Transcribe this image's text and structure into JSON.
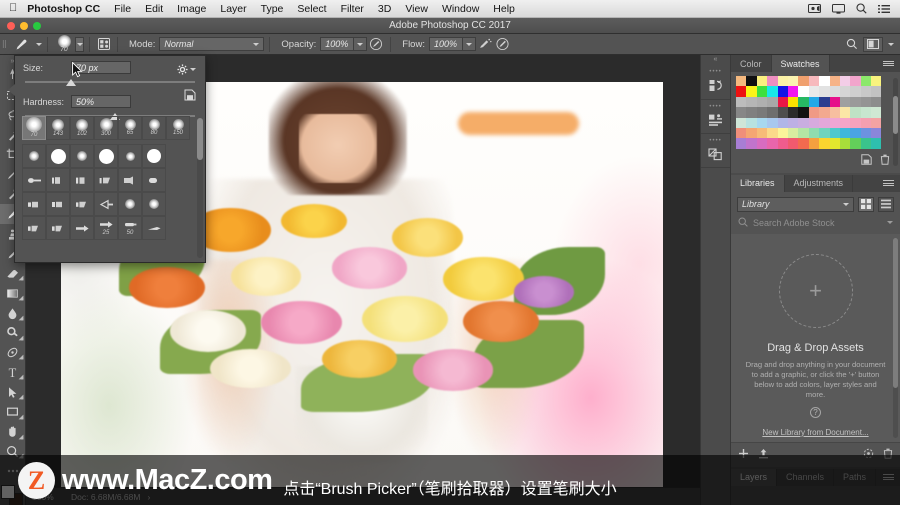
{
  "macbar": {
    "apple_icon": "apple-icon",
    "items": [
      {
        "label": "Photoshop CC",
        "bold": true
      },
      {
        "label": "File",
        "bold": false
      },
      {
        "label": "Edit",
        "bold": false
      },
      {
        "label": "Image",
        "bold": false
      },
      {
        "label": "Layer",
        "bold": false
      },
      {
        "label": "Type",
        "bold": false
      },
      {
        "label": "Select",
        "bold": false
      },
      {
        "label": "Filter",
        "bold": false
      },
      {
        "label": "3D",
        "bold": false
      },
      {
        "label": "View",
        "bold": false
      },
      {
        "label": "Window",
        "bold": false
      },
      {
        "label": "Help",
        "bold": false
      }
    ],
    "status_icons": [
      "screen-record-icon",
      "display-icon",
      "spotlight-search-icon",
      "control-center-icon"
    ]
  },
  "titlebar": {
    "title": "Adobe Photoshop CC 2017",
    "window_buttons": [
      "close-button",
      "minimize-button",
      "zoom-button"
    ]
  },
  "optionsbar": {
    "tool_icon": "brush-tool-icon",
    "brush_size_value": "70",
    "preset_picker_icon": "brush-preset-picker-icon",
    "toggle_panel_icon": "toggle-brush-panel-icon",
    "mode_label": "Mode:",
    "mode_value": "Normal",
    "opacity_label": "Opacity:",
    "opacity_value": "100%",
    "pressure_opacity_icon": "tablet-pressure-opacity-icon",
    "flow_label": "Flow:",
    "flow_value": "100%",
    "airbrush_icon": "airbrush-icon",
    "smoothing_icon": "smoothing-icon",
    "symmetry_icon": "symmetry-icon",
    "search_icon": "search-icon",
    "workspace_icon": "workspace-switcher-icon"
  },
  "tools": {
    "items": [
      {
        "name": "move-tool",
        "glyph": "move"
      },
      {
        "name": "marquee-tool",
        "glyph": "marquee"
      },
      {
        "name": "lasso-tool",
        "glyph": "lasso"
      },
      {
        "name": "quick-selection-tool",
        "glyph": "wand"
      },
      {
        "name": "crop-tool",
        "glyph": "crop"
      },
      {
        "name": "eyedropper-tool",
        "glyph": "eyedropper"
      },
      {
        "name": "healing-brush-tool",
        "glyph": "heal"
      },
      {
        "name": "brush-tool",
        "glyph": "brush",
        "selected": true
      },
      {
        "name": "clone-stamp-tool",
        "glyph": "stamp"
      },
      {
        "name": "history-brush-tool",
        "glyph": "historybrush"
      },
      {
        "name": "eraser-tool",
        "glyph": "eraser"
      },
      {
        "name": "gradient-tool",
        "glyph": "gradient"
      },
      {
        "name": "blur-tool",
        "glyph": "blur"
      },
      {
        "name": "dodge-tool",
        "glyph": "dodge"
      },
      {
        "name": "pen-tool",
        "glyph": "pen"
      },
      {
        "name": "type-tool",
        "glyph": "type"
      },
      {
        "name": "path-selection-tool",
        "glyph": "pathselect"
      },
      {
        "name": "rectangle-tool",
        "glyph": "rectangle"
      },
      {
        "name": "hand-tool",
        "glyph": "hand"
      },
      {
        "name": "zoom-tool",
        "glyph": "zoom"
      },
      {
        "name": "edit-toolbar",
        "glyph": "dots"
      }
    ],
    "foreground_color": "#ffffff",
    "background_color": "#3d2a20"
  },
  "brush_picker": {
    "size_label": "Size:",
    "size_value": "70 px",
    "size_slider_pct": 24,
    "hardness_label": "Hardness:",
    "hardness_value": "50%",
    "hardness_slider_pct": 50,
    "gear_icon": "settings-gear-icon",
    "new_preset_icon": "new-brush-preset-icon",
    "recent_row": [
      {
        "label": "70",
        "selected": true,
        "size": 16,
        "type": "soft"
      },
      {
        "label": "143",
        "selected": false,
        "size": 12,
        "type": "soft"
      },
      {
        "label": "102",
        "selected": false,
        "size": 12,
        "type": "soft"
      },
      {
        "label": "300",
        "selected": false,
        "size": 13,
        "type": "soft"
      },
      {
        "label": "65",
        "selected": false,
        "size": 11,
        "type": "soft"
      },
      {
        "label": "80",
        "selected": false,
        "size": 11,
        "type": "soft"
      },
      {
        "label": "150",
        "selected": false,
        "size": 11,
        "type": "soft"
      }
    ],
    "grid_rows": [
      [
        {
          "type": "soft",
          "size": 10,
          "label": ""
        },
        {
          "type": "hard",
          "size": 15,
          "label": ""
        },
        {
          "type": "soft",
          "size": 10,
          "label": ""
        },
        {
          "type": "hard",
          "size": 15,
          "label": ""
        },
        {
          "type": "soft",
          "size": 9,
          "label": ""
        },
        {
          "type": "hard",
          "size": 14,
          "label": ""
        }
      ],
      [
        {
          "type": "bristle",
          "size": 0,
          "label": ""
        },
        {
          "type": "bristle",
          "size": 0,
          "label": ""
        },
        {
          "type": "bristle",
          "size": 0,
          "label": ""
        },
        {
          "type": "bristle",
          "size": 0,
          "label": ""
        },
        {
          "type": "bristle",
          "size": 0,
          "label": ""
        },
        {
          "type": "bristle",
          "size": 0,
          "label": ""
        }
      ],
      [
        {
          "type": "bristle",
          "size": 0,
          "label": ""
        },
        {
          "type": "bristle",
          "size": 0,
          "label": ""
        },
        {
          "type": "bristle",
          "size": 0,
          "label": ""
        },
        {
          "type": "bristle",
          "size": 0,
          "label": ""
        },
        {
          "type": "soft",
          "size": 10,
          "label": ""
        },
        {
          "type": "soft",
          "size": 10,
          "label": ""
        }
      ],
      [
        {
          "type": "bristle",
          "size": 0,
          "label": ""
        },
        {
          "type": "bristle",
          "size": 0,
          "label": ""
        },
        {
          "type": "bristle",
          "size": 0,
          "label": ""
        },
        {
          "type": "bristle",
          "size": 0,
          "label": "25"
        },
        {
          "type": "bristle",
          "size": 0,
          "label": "50"
        },
        {
          "type": "bristle",
          "size": 0,
          "label": ""
        }
      ]
    ]
  },
  "canvas": {
    "stroke_color": "#f5a961",
    "document_background": "#ffffff"
  },
  "color_panel": {
    "tabs": [
      {
        "label": "Color",
        "active": false
      },
      {
        "label": "Swatches",
        "active": true
      }
    ],
    "menu_icon": "panel-menu-icon",
    "new_swatch_icon": "new-swatch-icon",
    "delete_swatch_icon": "delete-swatch-icon",
    "swatch_rows": [
      [
        "#f5b97f",
        "#111111",
        "#fbf080",
        "#ef8fc0",
        "#fbf2a6",
        "#fbf3b0",
        "#f0a06e",
        "#f7b9bd",
        "#ffffff",
        "#f6b387",
        "#f3cde7",
        "#f2a5cc",
        "#8ce86b",
        "#f9f37e"
      ],
      [
        "#ee1111",
        "#fbf417",
        "#3ee03e",
        "#18e8e8",
        "#1414e6",
        "#f117f1",
        "#ffffff",
        "#e9e9e9",
        "#e2e2e2",
        "#dcdcdc",
        "#d5d5d5",
        "#cfcfcf",
        "#c8c8c8",
        "#c2c2c2"
      ],
      [
        "#bcbcbc",
        "#b5b5b5",
        "#afafaf",
        "#a8a8a8",
        "#ea1745",
        "#fbe300",
        "#27b863",
        "#22a8e6",
        "#2b3d8f",
        "#e6108a",
        "#a0a0a0",
        "#9a9a9a",
        "#949494",
        "#8d8d8d"
      ],
      [
        "#878787",
        "#808080",
        "#7a7a7a",
        "#6e6e6e",
        "#4e4e4e",
        "#2b2b2b",
        "#111111",
        "#f09a85",
        "#f3a98f",
        "#f7bfa0",
        "#fbe6a6",
        "#bfe2c5",
        "#c7e6cf",
        "#cfe8d3"
      ],
      [
        "#cfe6d8",
        "#b8e2e0",
        "#a7d8ef",
        "#a8c8ee",
        "#b0b6e8",
        "#bdb0e4",
        "#c9aee0",
        "#d7aade",
        "#e3a8da",
        "#f0a6d4",
        "#f5a5c8",
        "#f7a2bc",
        "#f49fb0",
        "#f3a3a3"
      ],
      [
        "#f08f7a",
        "#f5a672",
        "#f7bb78",
        "#fbd98a",
        "#fbf49a",
        "#d8eea0",
        "#b4e6a4",
        "#8fdcae",
        "#6fd4bd",
        "#4fc9cc",
        "#3fb8dc",
        "#4aa4e2",
        "#6d92e0",
        "#8a86da"
      ],
      [
        "#a87ed4",
        "#c174cc",
        "#d86cc0",
        "#e965ab",
        "#ef5c8d",
        "#f05a6e",
        "#f36a4f",
        "#f5a03f",
        "#fbd42f",
        "#e3e72e",
        "#a8de3a",
        "#63cf5a",
        "#3ac48c",
        "#2ebfae"
      ]
    ]
  },
  "libraries_panel": {
    "tabs": [
      {
        "label": "Libraries",
        "active": true
      },
      {
        "label": "Adjustments",
        "active": false
      }
    ],
    "menu_icon": "panel-menu-icon",
    "library_select_value": "Library",
    "grid_view_icon": "grid-view-icon",
    "list_view_icon": "list-view-icon",
    "search_icon": "search-icon",
    "search_placeholder": "Search Adobe Stock",
    "dropdown_icon": "chevron-down-icon",
    "drop_title": "Drag & Drop Assets",
    "drop_text": "Drag and drop anything in your document to add a graphic, or click the '+' button below to add colors, layer styles and more.",
    "help_icon": "help-icon",
    "new_library_link": "New Library from Document...",
    "footer_icons": [
      "add-content-icon",
      "upload-icon",
      "sync-icon",
      "delete-icon"
    ]
  },
  "bottom_panel": {
    "tabs": [
      {
        "label": "Layers",
        "active": true
      },
      {
        "label": "Channels",
        "active": false
      },
      {
        "label": "Paths",
        "active": false
      }
    ],
    "menu_icon": "panel-menu-icon"
  },
  "dock_icons": [
    {
      "name": "history-panel-icon"
    },
    {
      "name": "properties-panel-icon"
    },
    {
      "name": "character-styles-panel-icon"
    }
  ],
  "statusbar": {
    "zoom_value": "100%",
    "doc_info": "Doc: 6.68M/6.68M",
    "arrow_icon": "chevron-right-icon"
  },
  "overlay": {
    "watermark_logo": "Z",
    "watermark_text": "www.MacZ.com",
    "caption": "点击“Brush Picker”（笔刷拾取器）设置笔刷大小"
  }
}
